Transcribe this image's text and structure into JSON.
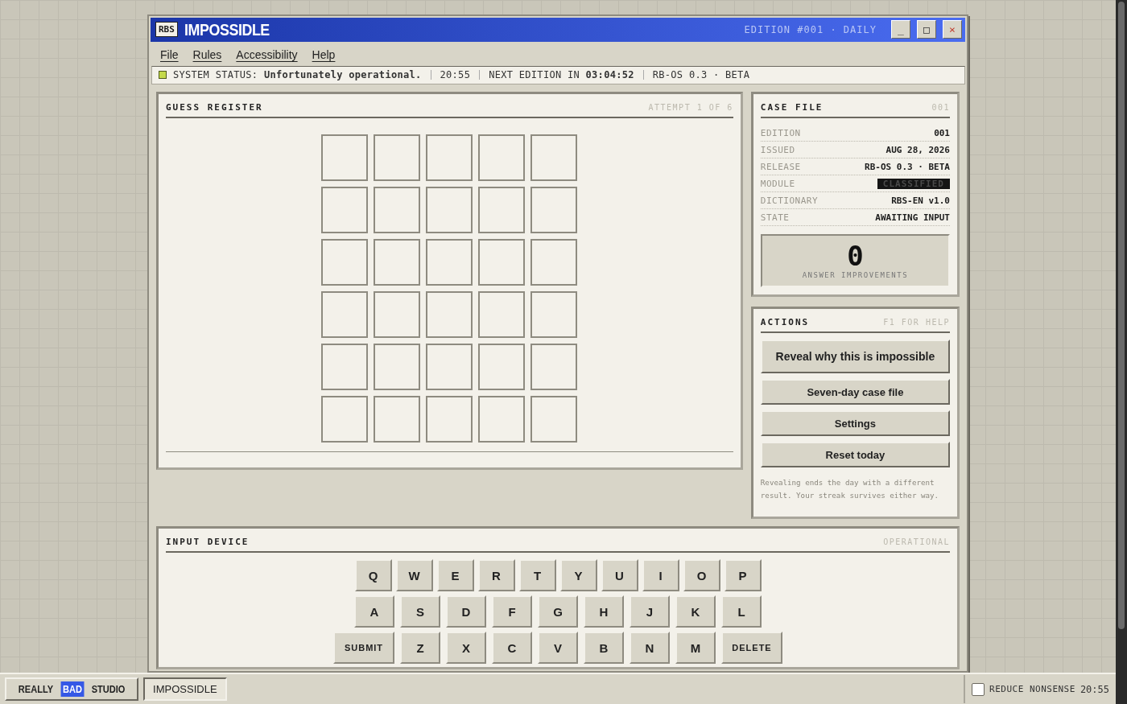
{
  "window": {
    "logo": "RBS",
    "title": "IMPOSSIDLE",
    "edition": "EDITION #001 · DAILY",
    "controls": [
      {
        "kind": "minimize",
        "label": "_"
      },
      {
        "kind": "maximize",
        "label": "□"
      },
      {
        "kind": "close",
        "label": "×"
      }
    ]
  },
  "menu": [
    {
      "label": "File"
    },
    {
      "label": "Rules"
    },
    {
      "label": "Accessibility"
    },
    {
      "label": "Help"
    }
  ],
  "status_bar": {
    "label": "SYSTEM STATUS:",
    "status": "Unfortunately operational.",
    "time": "20:55",
    "next_label": "NEXT EDITION IN",
    "next_time": "03:04:52",
    "version": "RB-OS 0.3 · BETA"
  },
  "guess_register": {
    "title": "GUESS REGISTER",
    "attempt": "ATTEMPT 1 OF 6",
    "rows": [
      {
        "tiles": [
          {
            "kind": "empty"
          },
          {
            "kind": "empty"
          },
          {
            "kind": "empty"
          },
          {
            "kind": "empty"
          },
          {
            "kind": "empty"
          }
        ]
      },
      {
        "tiles": [
          {
            "kind": "empty"
          },
          {
            "kind": "empty"
          },
          {
            "kind": "empty"
          },
          {
            "kind": "empty"
          },
          {
            "kind": "empty"
          }
        ]
      },
      {
        "tiles": [
          {
            "kind": "empty"
          },
          {
            "kind": "empty"
          },
          {
            "kind": "empty"
          },
          {
            "kind": "empty"
          },
          {
            "kind": "empty"
          }
        ]
      },
      {
        "tiles": [
          {
            "kind": "empty"
          },
          {
            "kind": "empty"
          },
          {
            "kind": "empty"
          },
          {
            "kind": "empty"
          },
          {
            "kind": "empty"
          }
        ]
      },
      {
        "tiles": [
          {
            "kind": "empty"
          },
          {
            "kind": "empty"
          },
          {
            "kind": "empty"
          },
          {
            "kind": "empty"
          },
          {
            "kind": "empty"
          }
        ]
      },
      {
        "tiles": [
          {
            "kind": "empty"
          },
          {
            "kind": "empty"
          },
          {
            "kind": "empty"
          },
          {
            "kind": "empty"
          },
          {
            "kind": "empty"
          }
        ]
      }
    ]
  },
  "case_file": {
    "title": "CASE FILE",
    "number": "001",
    "fields": [
      {
        "label": "EDITION",
        "value": "001",
        "kind": "text"
      },
      {
        "label": "ISSUED",
        "value": "AUG 28, 2026",
        "kind": "text"
      },
      {
        "label": "RELEASE",
        "value": "RB-OS 0.3 · BETA",
        "kind": "text"
      },
      {
        "label": "MODULE",
        "value": "CLASSIFIED",
        "kind": "redacted"
      },
      {
        "label": "DICTIONARY",
        "value": "RBS-EN v1.0",
        "kind": "text"
      },
      {
        "label": "STATE",
        "value": "AWAITING INPUT",
        "kind": "text"
      }
    ],
    "counter": {
      "value": "0",
      "label": "ANSWER IMPROVEMENTS"
    }
  },
  "actions": {
    "title": "ACTIONS",
    "hint": "F1 FOR HELP",
    "buttons": [
      {
        "label": "Reveal why this is impossible",
        "kind": "primary"
      },
      {
        "label": "Seven-day case file",
        "kind": "secondary"
      },
      {
        "label": "Settings",
        "kind": "secondary"
      },
      {
        "label": "Reset today",
        "kind": "secondary"
      }
    ],
    "note": "Revealing ends the day with a different result. Your streak survives either way."
  },
  "input_device": {
    "title": "INPUT DEVICE",
    "status": "OPERATIONAL",
    "rows": [
      {
        "keys": [
          {
            "label": "Q",
            "kind": "letter"
          },
          {
            "label": "W",
            "kind": "letter"
          },
          {
            "label": "E",
            "kind": "letter"
          },
          {
            "label": "R",
            "kind": "letter"
          },
          {
            "label": "T",
            "kind": "letter"
          },
          {
            "label": "Y",
            "kind": "letter"
          },
          {
            "label": "U",
            "kind": "letter"
          },
          {
            "label": "I",
            "kind": "letter"
          },
          {
            "label": "O",
            "kind": "letter"
          },
          {
            "label": "P",
            "kind": "letter"
          }
        ]
      },
      {
        "keys": [
          {
            "label": "A",
            "kind": "letter"
          },
          {
            "label": "S",
            "kind": "letter"
          },
          {
            "label": "D",
            "kind": "letter"
          },
          {
            "label": "F",
            "kind": "letter"
          },
          {
            "label": "G",
            "kind": "letter"
          },
          {
            "label": "H",
            "kind": "letter"
          },
          {
            "label": "J",
            "kind": "letter"
          },
          {
            "label": "K",
            "kind": "letter"
          },
          {
            "label": "L",
            "kind": "letter"
          }
        ]
      },
      {
        "keys": [
          {
            "label": "SUBMIT",
            "kind": "action"
          },
          {
            "label": "Z",
            "kind": "letter"
          },
          {
            "label": "X",
            "kind": "letter"
          },
          {
            "label": "C",
            "kind": "letter"
          },
          {
            "label": "V",
            "kind": "letter"
          },
          {
            "label": "B",
            "kind": "letter"
          },
          {
            "label": "N",
            "kind": "letter"
          },
          {
            "label": "M",
            "kind": "letter"
          },
          {
            "label": "DELETE",
            "kind": "action"
          }
        ]
      }
    ]
  },
  "taskbar": {
    "start": [
      {
        "label": "REALLY",
        "kind": "plain"
      },
      {
        "label": "BAD",
        "kind": "highlight"
      },
      {
        "label": "STUDIO",
        "kind": "plain"
      }
    ],
    "tasks": [
      {
        "label": "IMPOSSIDLE",
        "selected": true
      }
    ],
    "tray": {
      "checkbox_label": "REDUCE NONSENSE",
      "checked": false,
      "time": "20:55"
    }
  }
}
